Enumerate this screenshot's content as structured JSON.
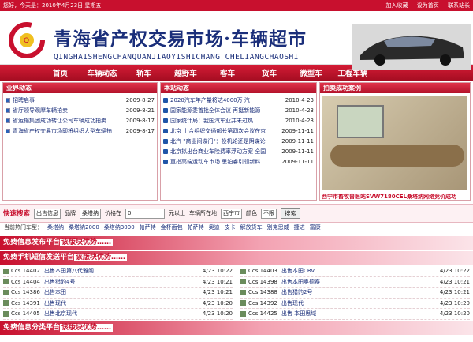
{
  "topbar": {
    "welcome": "您好，今天是：2010年4月23日 星期五",
    "links": [
      "加入收藏",
      "设为首页",
      "联系站长"
    ]
  },
  "header": {
    "title": "青海省产权交易市场·车辆超市",
    "subtitle": "QINGHAISHENGCHANQUANJIAOYISHICHANG  CHELIANGCHAOSHI"
  },
  "nav": [
    "首页",
    "车辆动态",
    "轿车",
    "越野车",
    "客车",
    "货车",
    "微型车",
    "工程车辆"
  ],
  "panel1": {
    "title": "业界动态",
    "items": [
      {
        "text": "招聘启事",
        "date": "2009-8-27"
      },
      {
        "text": "省厅领导观摩车辆拍卖",
        "date": "2009-8-21"
      },
      {
        "text": "省运输集团成功转让公司车辆成功拍卖",
        "date": "2009-8-17"
      },
      {
        "text": "青海省产权交易市场即将组织大型车辆拍",
        "date": "2009-8-17"
      }
    ]
  },
  "panel2": {
    "title": "本站动态",
    "items": [
      {
        "text": "2020汽车年产量将达4000万 汽",
        "date": "2010-4-23"
      },
      {
        "text": "国家能源委首批全体会议 再挺新能源",
        "date": "2010-4-23"
      },
      {
        "text": "国家统计局：我国汽车业并未过热",
        "date": "2010-4-23"
      },
      {
        "text": "北京 上合组织交通部长第四次会议在京",
        "date": "2009-11-11"
      },
      {
        "text": "北汽 \"商业间谍门\"：投机论还是阴谋论",
        "date": "2009-11-11"
      },
      {
        "text": "北京拟出台商业车险费率浮动方案 全国",
        "date": "2009-11-11"
      },
      {
        "text": "直指高端运动车市场 思铂睿引领新料",
        "date": "2009-11-11"
      }
    ]
  },
  "panel3": {
    "title": "拍卖成功案例",
    "caption": "西宁市畜牧兽医站SVW7180CEL桑塔纳网络竞价成功"
  },
  "search": {
    "label": "快速搜索",
    "type": "出售信息",
    "brand_label": "品牌",
    "brand": "桑塔纳",
    "price_label": "价格在",
    "price_value": "0",
    "price_unit": "元以上",
    "city_label": "车辆所在地",
    "city": "西宁市",
    "color_label": "颜色",
    "color": "不限",
    "button": "搜索"
  },
  "hot": {
    "label": "当前热门车型：",
    "items": [
      "桑塔纳",
      "桑塔纳2000",
      "桑塔纳3000",
      "帕萨特",
      "金杯面包",
      "帕萨特",
      "奥迪",
      "皮卡",
      "解放货车",
      "别克思威",
      "捷达",
      "富康"
    ]
  },
  "section1": {
    "title": "免费信息发布平台",
    "tag": "该版块优势……"
  },
  "section2": {
    "title": "免费手机短信发送平台",
    "tag": "该版块优势……"
  },
  "messages_left": [
    {
      "id": "Ccs 14402",
      "text": "出售本田第八代雅阁",
      "date": "4/23 10:22"
    },
    {
      "id": "Ccs 14404",
      "text": "出售猎豹4号",
      "date": "4/23 10:21"
    },
    {
      "id": "Ccs 14386",
      "text": "出售本田",
      "date": "4/23 10:21"
    },
    {
      "id": "Ccs 14391",
      "text": "出售现代",
      "date": "4/23 10:20"
    },
    {
      "id": "Ccs 14405",
      "text": "出售北京现代",
      "date": "4/23 10:20"
    }
  ],
  "messages_right": [
    {
      "id": "Ccs 14403",
      "text": "出售本田CRV",
      "date": "4/23 10:22"
    },
    {
      "id": "Ccs 14398",
      "text": "出售本田奥德赛",
      "date": "4/23 10:21"
    },
    {
      "id": "Ccs 14388",
      "text": "出售猎豹2号",
      "date": "4/23 10:21"
    },
    {
      "id": "Ccs 14392",
      "text": "出售现代",
      "date": "4/23 10:20"
    },
    {
      "id": "Ccs 14425",
      "text": "出售 本田思域",
      "date": "4/23 10:20"
    }
  ],
  "section3": {
    "title": "免费信息分类平台",
    "tag": "该版块优势……"
  }
}
